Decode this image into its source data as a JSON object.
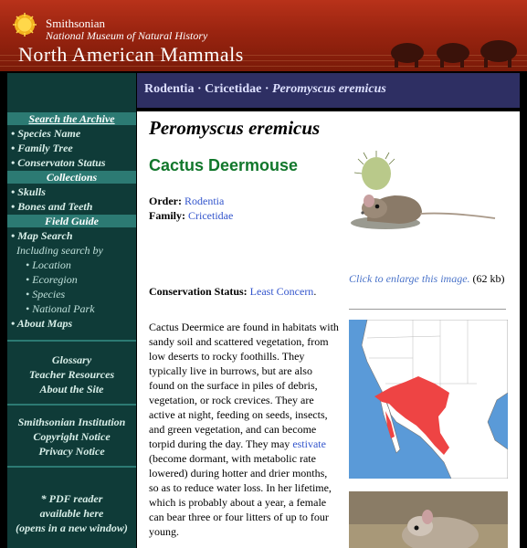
{
  "header": {
    "org": "Smithsonian",
    "museum": "National Museum of Natural History",
    "title": "North American Mammals"
  },
  "sidebar": {
    "sections": [
      {
        "heading": "Search the Archive",
        "links": [
          "• Species Name",
          "• Family Tree",
          "• Conservaton Status"
        ]
      },
      {
        "heading": "Collections",
        "links": [
          "• Skulls",
          "• Bones and Teeth"
        ]
      },
      {
        "heading": "Field Guide",
        "links": [
          "• Map Search"
        ]
      }
    ],
    "including": "Including search by",
    "sub_items": [
      "• Location",
      "• Ecoregion",
      "• Species",
      "• National Park"
    ],
    "about_maps": "• About Maps",
    "extra_links": [
      "Glossary",
      "Teacher Resources",
      "About the Site"
    ],
    "si_links": [
      "Smithsonian Institution",
      "Copyright Notice",
      "Privacy Notice"
    ],
    "pdf_note": [
      "* PDF reader",
      "available here",
      "(opens in a new window)"
    ]
  },
  "breadcrumb": {
    "order": "Rodentia",
    "sep1": " · ",
    "family": "Cricetidae",
    "sep2": " · ",
    "species": "Peromyscus eremicus"
  },
  "species": {
    "scientific_name": "Peromyscus eremicus",
    "common_name": "Cactus Deermouse",
    "order_label": "Order:",
    "order_value": "Rodentia",
    "family_label": "Family:",
    "family_value": "Cricetidae",
    "conservation_label": "Conservation Status:",
    "conservation_value": "Least Concern",
    "enlarge_link": "Click to enlarge this image.",
    "enlarge_size": "(62 kb)",
    "description_1": "Cactus Deermice are found in habitats with sandy soil and scattered vegetation, from low deserts to rocky foothills. They typically live in burrows, but are also found on the surface in piles of debris, vegetation, or rock crevices. They are active at night, feeding on seeds, insects, and green vegetation, and can become torpid during the day. They may ",
    "estivate_link": "estivate",
    "description_2": " (become dormant, with metabolic rate lowered) during hotter and drier months, so as to reduce water loss. In her lifetime, which is probably about a year, a female can bear three or four litters of up to four young."
  },
  "colors": {
    "banner": "#9a2410",
    "sidebar_bg": "#0f3b38",
    "sidebar_heading": "#2c7a73",
    "breadcrumb_bg": "#2e2f63",
    "common_name": "#11772b",
    "link": "#3355cc",
    "range_fill": "#ee4444"
  },
  "icons": [
    "smithsonian-sun-logo",
    "musk-ox-silhouettes"
  ]
}
